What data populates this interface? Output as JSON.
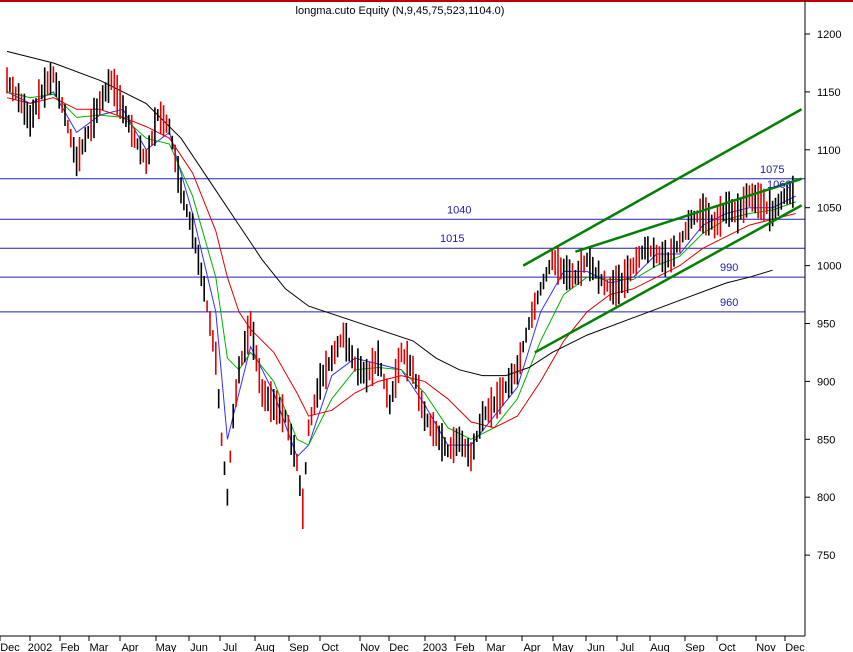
{
  "chart_data": {
    "type": "line",
    "title": "longma.cuto Equity (N,9,45,75,523,1104.0)",
    "xlabel": "",
    "ylabel": "",
    "ylim": [
      735,
      1230
    ],
    "y_ticks": [
      750,
      800,
      850,
      900,
      950,
      1000,
      1050,
      1100,
      1150,
      1200
    ],
    "x_ticks": [
      "Dec",
      "2002",
      "Feb",
      "Mar",
      "Apr",
      "May",
      "Jun",
      "Jul",
      "Aug",
      "Sep",
      "Oct",
      "Nov",
      "Dec",
      "2003",
      "Feb",
      "Mar",
      "Apr",
      "May",
      "Jun",
      "Jul",
      "Aug",
      "Sep",
      "Oct",
      "Nov",
      "Dec"
    ],
    "price_path": [
      [
        0,
        1160
      ],
      [
        2,
        1145
      ],
      [
        4,
        1125
      ],
      [
        6,
        1150
      ],
      [
        8,
        1165
      ],
      [
        10,
        1130
      ],
      [
        12,
        1090
      ],
      [
        14,
        1115
      ],
      [
        16,
        1140
      ],
      [
        18,
        1160
      ],
      [
        20,
        1135
      ],
      [
        22,
        1110
      ],
      [
        24,
        1090
      ],
      [
        26,
        1130
      ],
      [
        28,
        1120
      ],
      [
        30,
        1065
      ],
      [
        32,
        1030
      ],
      [
        34,
        980
      ],
      [
        36,
        920
      ],
      [
        37,
        850
      ],
      [
        38,
        800
      ],
      [
        39,
        870
      ],
      [
        40,
        910
      ],
      [
        42,
        950
      ],
      [
        44,
        890
      ],
      [
        46,
        880
      ],
      [
        48,
        870
      ],
      [
        50,
        830
      ],
      [
        51,
        790
      ],
      [
        52,
        860
      ],
      [
        54,
        900
      ],
      [
        56,
        920
      ],
      [
        58,
        940
      ],
      [
        60,
        915
      ],
      [
        62,
        905
      ],
      [
        64,
        920
      ],
      [
        66,
        880
      ],
      [
        68,
        925
      ],
      [
        70,
        910
      ],
      [
        72,
        870
      ],
      [
        74,
        855
      ],
      [
        76,
        840
      ],
      [
        78,
        850
      ],
      [
        80,
        835
      ],
      [
        82,
        870
      ],
      [
        84,
        880
      ],
      [
        86,
        895
      ],
      [
        88,
        910
      ],
      [
        90,
        950
      ],
      [
        92,
        980
      ],
      [
        94,
        1005
      ],
      [
        96,
        995
      ],
      [
        98,
        990
      ],
      [
        100,
        1005
      ],
      [
        102,
        990
      ],
      [
        104,
        980
      ],
      [
        106,
        985
      ],
      [
        108,
        1000
      ],
      [
        110,
        1015
      ],
      [
        112,
        1010
      ],
      [
        114,
        1005
      ],
      [
        116,
        1020
      ],
      [
        118,
        1040
      ],
      [
        120,
        1045
      ],
      [
        122,
        1035
      ],
      [
        124,
        1050
      ],
      [
        126,
        1045
      ],
      [
        128,
        1060
      ],
      [
        130,
        1055
      ],
      [
        132,
        1045
      ],
      [
        134,
        1060
      ],
      [
        136,
        1065
      ]
    ],
    "moving_averages": [
      {
        "color": "#3030ff",
        "path": [
          [
            0,
            1150
          ],
          [
            4,
            1140
          ],
          [
            8,
            1150
          ],
          [
            12,
            1115
          ],
          [
            16,
            1130
          ],
          [
            20,
            1135
          ],
          [
            24,
            1100
          ],
          [
            28,
            1115
          ],
          [
            32,
            1045
          ],
          [
            36,
            960
          ],
          [
            38,
            850
          ],
          [
            40,
            890
          ],
          [
            42,
            930
          ],
          [
            46,
            890
          ],
          [
            50,
            835
          ],
          [
            52,
            845
          ],
          [
            56,
            905
          ],
          [
            60,
            920
          ],
          [
            64,
            915
          ],
          [
            68,
            910
          ],
          [
            72,
            880
          ],
          [
            76,
            845
          ],
          [
            80,
            845
          ],
          [
            84,
            870
          ],
          [
            88,
            895
          ],
          [
            92,
            960
          ],
          [
            96,
            995
          ],
          [
            100,
            995
          ],
          [
            104,
            985
          ],
          [
            108,
            990
          ],
          [
            112,
            1010
          ],
          [
            116,
            1010
          ],
          [
            120,
            1035
          ],
          [
            124,
            1045
          ],
          [
            128,
            1050
          ],
          [
            132,
            1050
          ],
          [
            136,
            1060
          ]
        ]
      },
      {
        "color": "#00b000",
        "path": [
          [
            0,
            1150
          ],
          [
            4,
            1145
          ],
          [
            8,
            1148
          ],
          [
            12,
            1128
          ],
          [
            16,
            1130
          ],
          [
            20,
            1128
          ],
          [
            24,
            1110
          ],
          [
            28,
            1105
          ],
          [
            32,
            1060
          ],
          [
            36,
            990
          ],
          [
            38,
            920
          ],
          [
            40,
            910
          ],
          [
            42,
            925
          ],
          [
            46,
            900
          ],
          [
            50,
            850
          ],
          [
            52,
            845
          ],
          [
            56,
            885
          ],
          [
            60,
            910
          ],
          [
            64,
            912
          ],
          [
            68,
            910
          ],
          [
            72,
            890
          ],
          [
            76,
            860
          ],
          [
            80,
            850
          ],
          [
            84,
            860
          ],
          [
            88,
            885
          ],
          [
            92,
            935
          ],
          [
            96,
            975
          ],
          [
            100,
            990
          ],
          [
            104,
            988
          ],
          [
            108,
            988
          ],
          [
            112,
            1000
          ],
          [
            116,
            1008
          ],
          [
            120,
            1028
          ],
          [
            124,
            1040
          ],
          [
            128,
            1045
          ],
          [
            132,
            1048
          ],
          [
            136,
            1055
          ]
        ]
      },
      {
        "color": "#e00000",
        "path": [
          [
            0,
            1145
          ],
          [
            4,
            1140
          ],
          [
            8,
            1145
          ],
          [
            12,
            1135
          ],
          [
            16,
            1135
          ],
          [
            20,
            1128
          ],
          [
            24,
            1120
          ],
          [
            28,
            1110
          ],
          [
            32,
            1080
          ],
          [
            36,
            1030
          ],
          [
            38,
            990
          ],
          [
            40,
            960
          ],
          [
            42,
            945
          ],
          [
            46,
            925
          ],
          [
            50,
            890
          ],
          [
            52,
            870
          ],
          [
            56,
            875
          ],
          [
            60,
            890
          ],
          [
            64,
            900
          ],
          [
            68,
            905
          ],
          [
            72,
            900
          ],
          [
            76,
            885
          ],
          [
            80,
            865
          ],
          [
            84,
            860
          ],
          [
            88,
            870
          ],
          [
            92,
            900
          ],
          [
            96,
            935
          ],
          [
            100,
            960
          ],
          [
            104,
            975
          ],
          [
            108,
            980
          ],
          [
            112,
            990
          ],
          [
            116,
            1000
          ],
          [
            120,
            1015
          ],
          [
            124,
            1025
          ],
          [
            128,
            1035
          ],
          [
            132,
            1040
          ],
          [
            136,
            1045
          ]
        ]
      },
      {
        "color": "#000000",
        "path": [
          [
            0,
            1185
          ],
          [
            8,
            1175
          ],
          [
            16,
            1160
          ],
          [
            24,
            1140
          ],
          [
            30,
            1110
          ],
          [
            36,
            1065
          ],
          [
            40,
            1035
          ],
          [
            44,
            1005
          ],
          [
            48,
            980
          ],
          [
            52,
            965
          ],
          [
            58,
            955
          ],
          [
            64,
            945
          ],
          [
            70,
            935
          ],
          [
            74,
            920
          ],
          [
            78,
            910
          ],
          [
            82,
            905
          ],
          [
            86,
            905
          ],
          [
            90,
            912
          ],
          [
            94,
            925
          ],
          [
            100,
            940
          ],
          [
            108,
            955
          ],
          [
            116,
            970
          ],
          [
            124,
            985
          ],
          [
            128,
            990
          ],
          [
            132,
            996
          ]
        ]
      }
    ],
    "horizontal_levels": [
      {
        "value": 1075,
        "label": "1075"
      },
      {
        "value": 1040,
        "label": "1040"
      },
      {
        "value": 1015,
        "label": "1015"
      },
      {
        "value": 990,
        "label": "990"
      },
      {
        "value": 960,
        "label": "960"
      }
    ],
    "inline_label": "1063",
    "trend_lines": [
      {
        "from": [
          89,
          1000
        ],
        "to": [
          137,
          1135
        ]
      },
      {
        "from": [
          98,
          1012
        ],
        "to": [
          137,
          1075
        ]
      },
      {
        "from": [
          91,
          925
        ],
        "to": [
          137,
          1052
        ]
      }
    ]
  }
}
